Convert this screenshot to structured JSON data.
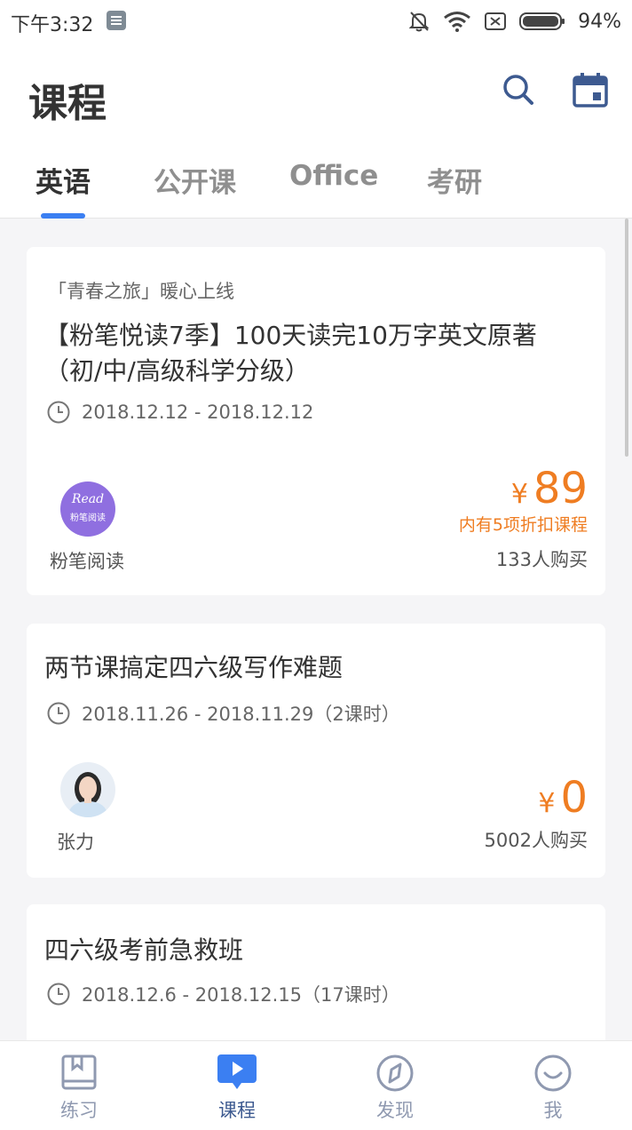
{
  "status_bar": {
    "time": "下午3:32",
    "battery": "94%"
  },
  "header": {
    "title": "课程",
    "search_icon": "search-icon",
    "calendar_icon": "calendar-icon"
  },
  "tabs": [
    {
      "label": "英语",
      "active": true
    },
    {
      "label": "公开课",
      "active": false
    },
    {
      "label": "Office",
      "active": false
    },
    {
      "label": "考研",
      "active": false
    }
  ],
  "courses": [
    {
      "tag": "「青春之旅」暖心上线",
      "title": "【粉笔悦读7季】100天读完10万字英文原著（初/中/高级科学分级）",
      "date": "2018.12.12 - 2018.12.12",
      "author": "粉笔阅读",
      "avatar_line1": "Read",
      "avatar_line2": "粉笔阅读",
      "price_symbol": "¥",
      "price": "89",
      "discount_note": "内有5项折扣课程",
      "buyers": "133人购买"
    },
    {
      "title": "两节课搞定四六级写作难题",
      "date": "2018.11.26 - 2018.11.29（2课时）",
      "author": "张力",
      "price_symbol": "¥",
      "price": "0",
      "buyers": "5002人购买"
    },
    {
      "title": "四六级考前急救班",
      "date": "2018.12.6 - 2018.12.15（17课时）"
    }
  ],
  "bottom_nav": [
    {
      "label": "练习",
      "icon": "practice-book-icon",
      "active": false
    },
    {
      "label": "课程",
      "icon": "play-icon",
      "active": true
    },
    {
      "label": "发现",
      "icon": "compass-icon",
      "active": false
    },
    {
      "label": "我",
      "icon": "profile-smile-icon",
      "active": false
    }
  ],
  "colors": {
    "accent_blue": "#3b7ff2",
    "price_orange": "#ef7d22",
    "nav_active": "#3d5a90",
    "nav_inactive": "#8f99b0",
    "avatar_purple": "#8f6fe0"
  }
}
